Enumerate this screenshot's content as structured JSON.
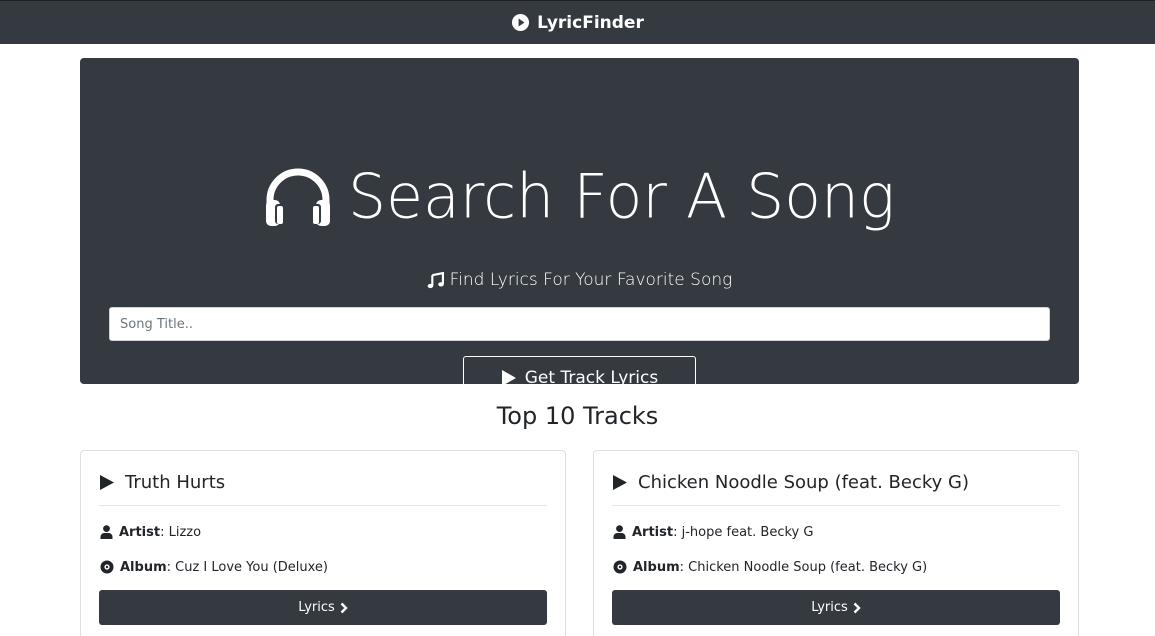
{
  "navbar": {
    "brand": "LyricFinder",
    "brand_icon": "play-circle-icon"
  },
  "hero": {
    "title": "Search For A Song",
    "title_icon": "headphones-icon",
    "subtitle": "Find Lyrics For Your Favorite Song",
    "subtitle_icon": "music-note-icon",
    "search_placeholder": "Song Title..",
    "search_value": "",
    "button_label": "Get Track Lyrics",
    "button_icon": "play-icon"
  },
  "top_tracks": {
    "heading": "Top 10 Tracks",
    "tracks": [
      {
        "title": "Truth Hurts",
        "artist_label": "Artist",
        "artist": "Lizzo",
        "album_label": "Album",
        "album": "Cuz I Love You (Deluxe)",
        "button_label": "Lyrics"
      },
      {
        "title": "Chicken Noodle Soup (feat. Becky G)",
        "artist_label": "Artist",
        "artist": "j-hope feat. Becky G",
        "album_label": "Album",
        "album": "Chicken Noodle Soup (feat. Becky G)",
        "button_label": "Lyrics"
      }
    ]
  },
  "colors": {
    "dark": "#343a40",
    "white": "#ffffff",
    "text": "#212529"
  }
}
